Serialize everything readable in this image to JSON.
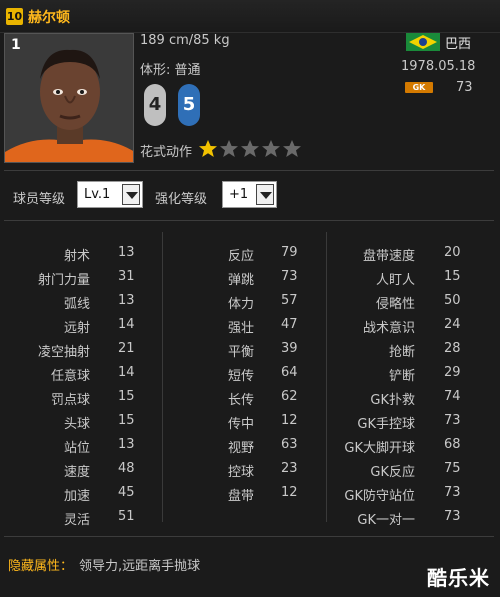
{
  "header": {
    "season_badge": "10",
    "name": "赫尔顿"
  },
  "player": {
    "position_number": "1",
    "height_weight": "189 cm/85 kg",
    "body_type": "体形: 普通",
    "country": "巴西",
    "birth_date": "1978.05.18",
    "position_badge": "GK",
    "position_rating": "73",
    "weak_foot": "4",
    "strong_foot": "5",
    "skill_moves_label": "花式动作",
    "skill_stars": 1,
    "skill_stars_max": 5
  },
  "controls": {
    "level_label": "球员等级",
    "level_value": "Lv.1",
    "enhance_label": "强化等级",
    "enhance_value": "+1"
  },
  "stats": {
    "col1": [
      {
        "name": "射术",
        "value": "13"
      },
      {
        "name": "射门力量",
        "value": "31"
      },
      {
        "name": "弧线",
        "value": "13"
      },
      {
        "name": "远射",
        "value": "14"
      },
      {
        "name": "凌空抽射",
        "value": "21"
      },
      {
        "name": "任意球",
        "value": "14"
      },
      {
        "name": "罚点球",
        "value": "15"
      },
      {
        "name": "头球",
        "value": "15"
      },
      {
        "name": "站位",
        "value": "13"
      },
      {
        "name": "速度",
        "value": "48"
      },
      {
        "name": "加速",
        "value": "45"
      },
      {
        "name": "灵活",
        "value": "51"
      }
    ],
    "col2": [
      {
        "name": "反应",
        "value": "79"
      },
      {
        "name": "弹跳",
        "value": "73"
      },
      {
        "name": "体力",
        "value": "57"
      },
      {
        "name": "强壮",
        "value": "47"
      },
      {
        "name": "平衡",
        "value": "39"
      },
      {
        "name": "短传",
        "value": "64"
      },
      {
        "name": "长传",
        "value": "62"
      },
      {
        "name": "传中",
        "value": "12"
      },
      {
        "name": "视野",
        "value": "63"
      },
      {
        "name": "控球",
        "value": "23"
      },
      {
        "name": "盘带",
        "value": "12"
      }
    ],
    "col3": [
      {
        "name": "盘带速度",
        "value": "20"
      },
      {
        "name": "人盯人",
        "value": "15"
      },
      {
        "name": "侵略性",
        "value": "50"
      },
      {
        "name": "战术意识",
        "value": "24"
      },
      {
        "name": "抢断",
        "value": "28"
      },
      {
        "name": "铲断",
        "value": "29"
      },
      {
        "name": "GK扑救",
        "value": "74"
      },
      {
        "name": "GK手控球",
        "value": "73"
      },
      {
        "name": "GK大脚开球",
        "value": "68"
      },
      {
        "name": "GK反应",
        "value": "75"
      },
      {
        "name": "GK防守站位",
        "value": "73"
      },
      {
        "name": "GK一对一",
        "value": "73"
      }
    ]
  },
  "hidden_attributes": {
    "label": "隐藏属性：",
    "text": "领导力,远距离手抛球"
  },
  "watermark": "酷乐米",
  "colors": {
    "accent": "#ffb81c",
    "star_filled": "#f2c200",
    "star_empty": "#6a6a6a",
    "gk_badge": "#d47a00",
    "strong_foot": "#2f6fb7"
  }
}
